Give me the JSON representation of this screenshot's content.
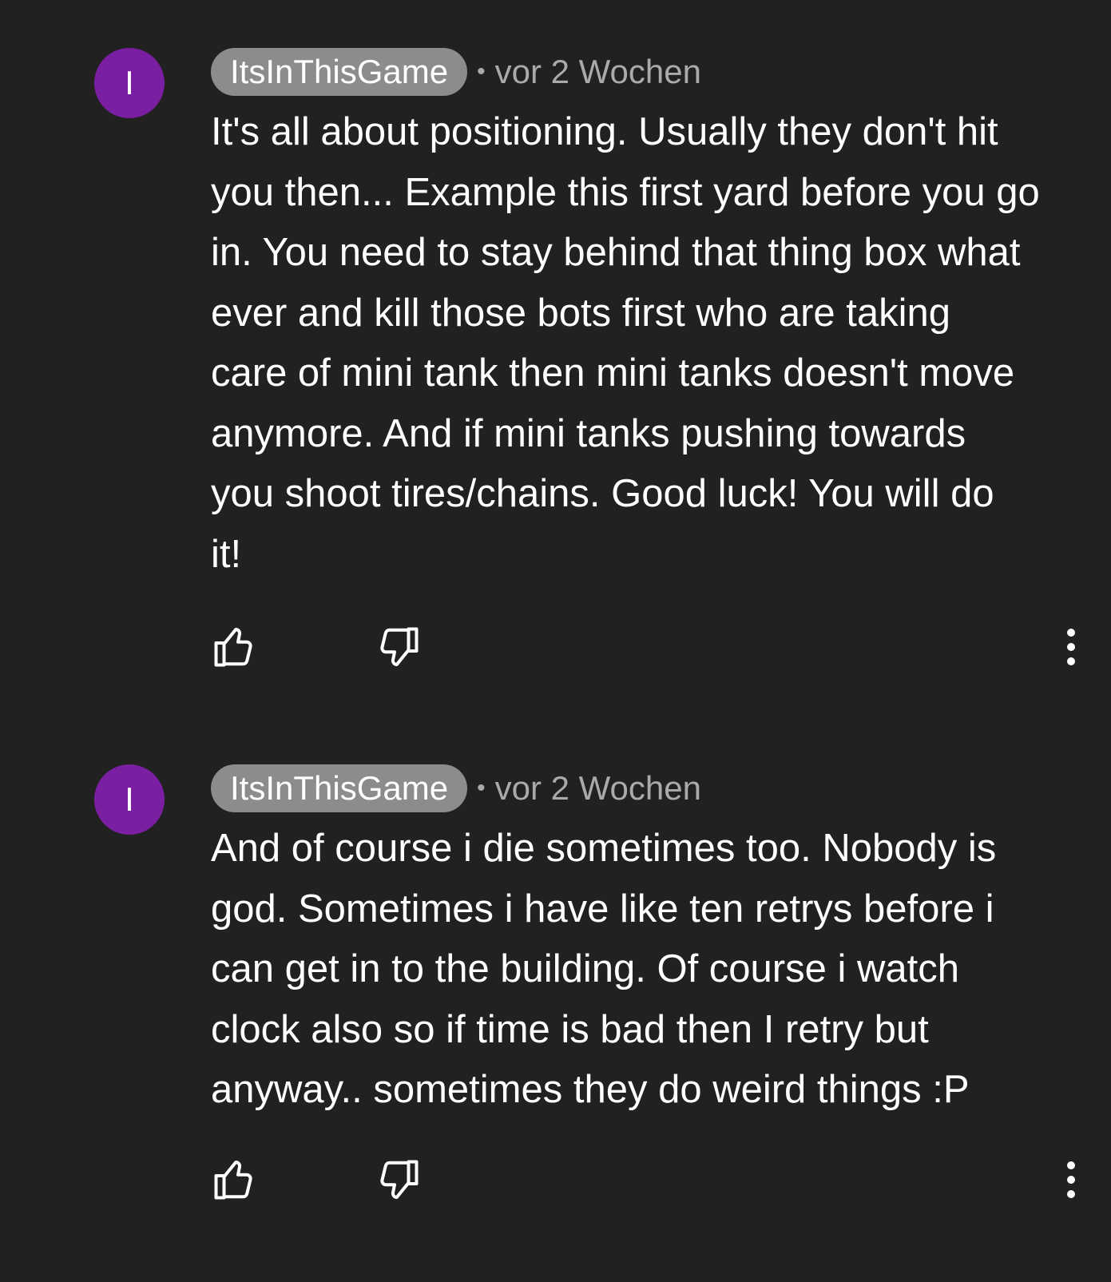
{
  "comments": [
    {
      "avatar_letter": "I",
      "author": "ItsInThisGame",
      "separator": "•",
      "timestamp": "vor 2 Wochen",
      "lines": [
        "It's all about positioning. Usually they don't hit",
        "you then... Example this first yard before you go",
        "in. You need to stay behind that thing box what",
        "ever and kill those bots first who are taking",
        "care of mini tank then mini tanks doesn't move",
        "anymore. And if mini tanks pushing towards",
        "you shoot tires/chains. Good luck! You will do",
        "it!"
      ],
      "actions": {
        "like_icon": "thumb-up-icon",
        "dislike_icon": "thumb-down-icon",
        "menu_icon": "more-vertical-icon"
      }
    },
    {
      "avatar_letter": "I",
      "author": "ItsInThisGame",
      "separator": "•",
      "timestamp": "vor 2 Wochen",
      "lines": [
        "And of course i die sometimes too. Nobody is",
        "god. Sometimes i have like ten retrys before i",
        "can get in to the building. Of course i watch",
        "clock also so if time is bad then I retry but",
        "anyway.. sometimes they do weird things :P"
      ],
      "actions": {
        "like_icon": "thumb-up-icon",
        "dislike_icon": "thumb-down-icon",
        "menu_icon": "more-vertical-icon"
      }
    }
  ],
  "colors": {
    "background": "#212121",
    "avatar": "#7b1fa2",
    "author_chip": "#8c8c8c",
    "meta_text": "#aaaaaa",
    "text": "#ffffff"
  }
}
